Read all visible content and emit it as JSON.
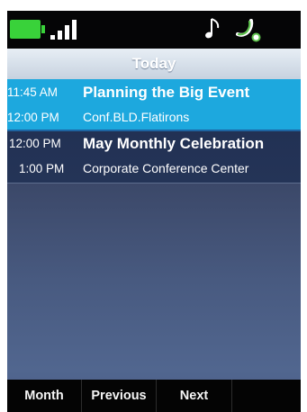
{
  "header": {
    "title": "Today"
  },
  "status_bar": {
    "icons": [
      "battery-icon",
      "signal-icon",
      "music-note-icon",
      "phone-icon"
    ],
    "colors": {
      "battery": "#39d23a",
      "phone": "#5ec24d"
    }
  },
  "events": [
    {
      "start_time": "11:45 AM",
      "end_time": "12:00 PM",
      "title": "Planning the Big Event",
      "location": "Conf.BLD.Flatirons",
      "selected": true
    },
    {
      "start_time": "12:00 PM",
      "end_time": "1:00 PM",
      "title": "May Monthly Celebration",
      "location": "Corporate Conference Center",
      "selected": false
    }
  ],
  "softkeys": [
    {
      "label": "Month"
    },
    {
      "label": "Previous"
    },
    {
      "label": "Next"
    },
    {
      "label": ""
    }
  ],
  "theme": {
    "selected_color": "#1da8de",
    "background_color": "#3e4a6a",
    "footer_color": "#040404"
  }
}
